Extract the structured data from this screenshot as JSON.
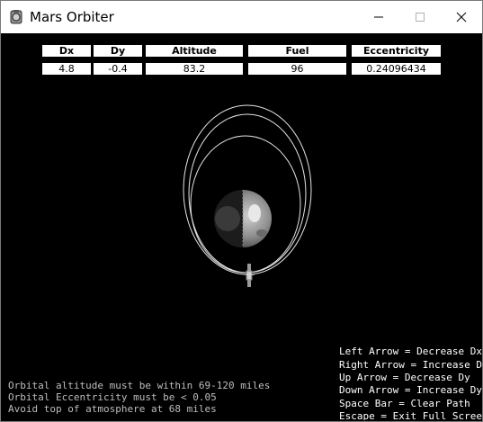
{
  "window": {
    "title": "Mars Orbiter",
    "icons": {
      "app": "mars-orbiter-app-icon",
      "minimize": "minimize-icon",
      "maximize": "maximize-icon",
      "close": "close-icon"
    }
  },
  "hud": {
    "headers": [
      "Dx",
      "Dy",
      "Altitude",
      "Fuel",
      "Eccentricity"
    ],
    "values": [
      "4.8",
      "-0.4",
      "83.2",
      "96",
      "0.24096434"
    ]
  },
  "messages": [
    "Orbital altitude must be within 69-120 miles",
    "Orbital Eccentricity must be < 0.05",
    "Avoid top of atmosphere at 68 miles"
  ],
  "controls": [
    "Left Arrow = Decrease Dx",
    "Right Arrow = Increase Dx",
    "Up Arrow = Decrease Dy",
    "Down Arrow = Increase Dy",
    "Space Bar = Clear Path",
    "Escape = Exit Full Screen"
  ],
  "colors": {
    "background": "#000000",
    "hud_box": "#ffffff",
    "orbit_path": "#e6e6e6",
    "message_text": "#bdbdbd",
    "controls_text": "#ffffff"
  }
}
